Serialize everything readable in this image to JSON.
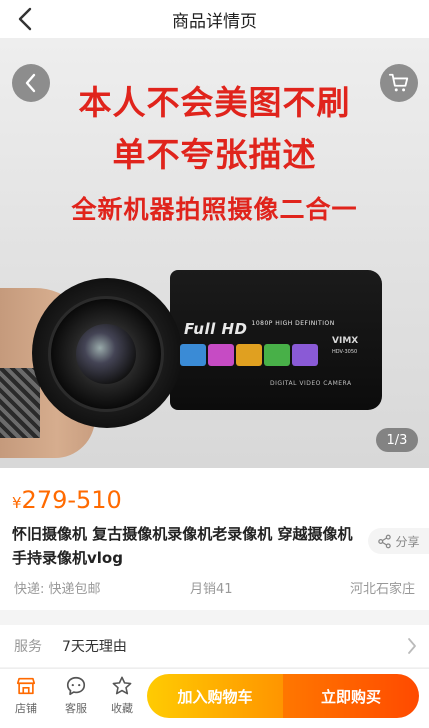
{
  "header": {
    "title": "商品详情页"
  },
  "gallery": {
    "overlay_lines": [
      "本人不会美图不刷",
      "单不夸张描述",
      "全新机器拍照摄像二合一"
    ],
    "counter": "1/3",
    "camera": {
      "display_text": "Full HD",
      "display_sub": "1080P HIGH DEFINITION",
      "brand": "VIMX",
      "model": "HDV-3050",
      "footer": "DIGITAL VIDEO CAMERA"
    }
  },
  "product": {
    "currency": "¥",
    "price": "279-510",
    "title": "怀旧摄像机 复古摄像机录像机老录像机 穿越摄像机手持录像机vlog",
    "share_label": "分享",
    "shipping": "快递: 快递包邮",
    "monthly_sales": "月销41",
    "location": "河北石家庄"
  },
  "service": {
    "label": "服务",
    "value": "7天无理由"
  },
  "bottom_bar": {
    "shop_label": "店铺",
    "service_label": "客服",
    "favorite_label": "收藏",
    "add_to_cart": "加入购物车",
    "buy_now": "立即购买"
  },
  "colors": {
    "price": "#ff6a00",
    "overlay_text": "#e0241c",
    "cart_button": "#ff9500",
    "buy_button": "#ff4a00"
  }
}
